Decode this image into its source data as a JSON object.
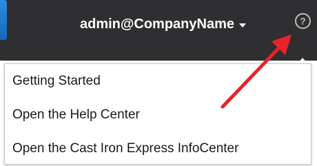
{
  "header": {
    "user_label": "admin@CompanyName",
    "help_icon": "question-circle-icon",
    "caret_icon": "caret-down-icon"
  },
  "help_menu": {
    "items": [
      {
        "label": "Getting Started"
      },
      {
        "label": "Open the Help Center"
      },
      {
        "label": "Open the Cast Iron Express InfoCenter"
      }
    ]
  },
  "colors": {
    "topbar": "#2f2f31",
    "accent_blue": "#1e7ad2",
    "annotation_arrow": "#e8232a"
  }
}
